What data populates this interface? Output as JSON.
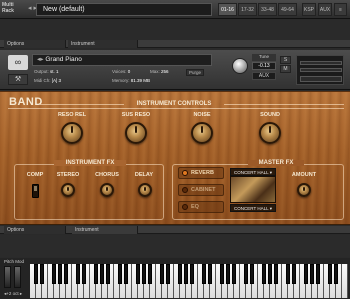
{
  "topbar": {
    "multirack_label_1": "Multi",
    "multirack_label_2": "Rack",
    "arrows": "◂ ▸",
    "rack_name": "New (default)",
    "page_buttons": [
      "01-16",
      "17-32",
      "33-48",
      "49-64"
    ],
    "kbd_btn": "KSP",
    "aux_btn": "AUX"
  },
  "slot_top": {
    "tab_options": "Options",
    "tab_instrument": "Instrument"
  },
  "instrument": {
    "name": "Grand Piano",
    "output_label": "Output:",
    "output_value": "st. 1",
    "voices_label": "Voices:",
    "voices_value": "0",
    "max_label": "Max:",
    "max_value": "256",
    "purge_label": "Purge",
    "midi_label": "Midi Ch:",
    "midi_value": "[A] 3",
    "memory_label": "Memory:",
    "memory_value": "81.39 MB",
    "tune_label": "Tune",
    "tune_value": "-0.13",
    "solo": "S",
    "mute": "M",
    "aux": "AUX"
  },
  "panel": {
    "band_title": "BAND",
    "instrument_controls_title": "INSTRUMENT CONTROLS",
    "controls": [
      "RESO REL",
      "SUS RESO",
      "NOISE",
      "SOUND"
    ],
    "instrument_fx_title": "INSTRUMENT FX",
    "fx_knobs": [
      "COMP",
      "STEREO",
      "CHORUS",
      "DELAY"
    ],
    "fx_buttons": [
      "REVERB",
      "CABINET",
      "EQ"
    ],
    "master_fx_title": "MASTER FX",
    "room_top": "CONCERT HALL ▾",
    "room_bottom": "CONCERT HALL ▾",
    "amount_label": "AMOUNT"
  },
  "slot_bottom": {
    "tab_options": "Options",
    "tab_instrument": "Instrument"
  },
  "keyboard": {
    "pitch_mod": "Pitch Mod",
    "octave": "◂+2 oct ▸"
  }
}
